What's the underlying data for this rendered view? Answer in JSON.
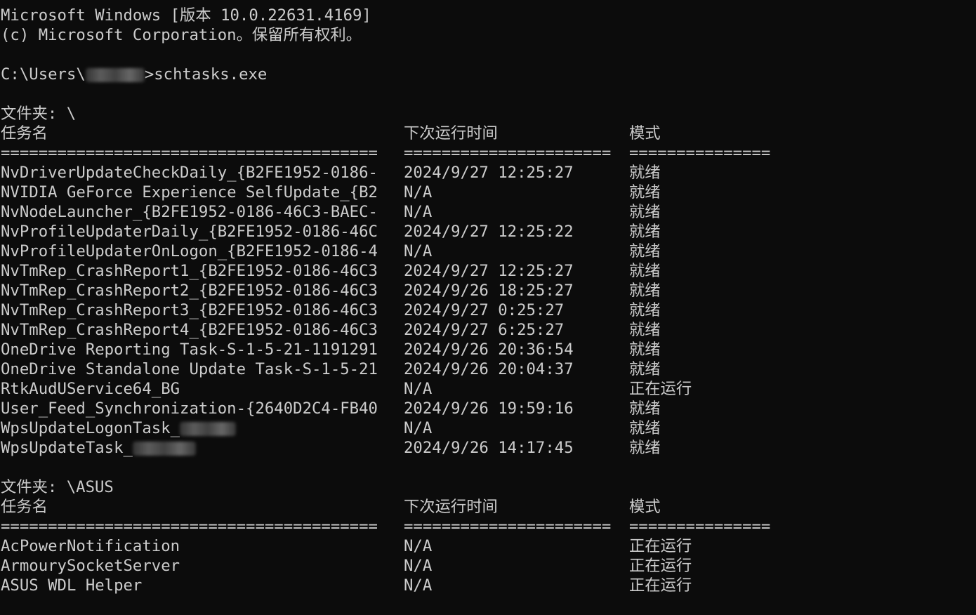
{
  "header": {
    "version_line": "Microsoft Windows [版本 10.0.22631.4169]",
    "copyright_line": "(c) Microsoft Corporation。保留所有权利。"
  },
  "prompt": {
    "path_prefix": "C:\\Users\\",
    "command": ">schtasks.exe"
  },
  "sections": [
    {
      "folder_label": "文件夹: \\",
      "headers": [
        "任务名",
        "下次运行时间",
        "模式"
      ],
      "separators": [
        "========================================",
        "======================",
        "==============="
      ],
      "rows": [
        {
          "name": "NvDriverUpdateCheckDaily_{B2FE1952-0186-",
          "next_run": "2024/9/27 12:25:27",
          "status": "就绪"
        },
        {
          "name": "NVIDIA GeForce Experience SelfUpdate_{B2",
          "next_run": "N/A",
          "status": "就绪"
        },
        {
          "name": "NvNodeLauncher_{B2FE1952-0186-46C3-BAEC-",
          "next_run": "N/A",
          "status": "就绪"
        },
        {
          "name": "NvProfileUpdaterDaily_{B2FE1952-0186-46C",
          "next_run": "2024/9/27 12:25:22",
          "status": "就绪"
        },
        {
          "name": "NvProfileUpdaterOnLogon_{B2FE1952-0186-4",
          "next_run": "N/A",
          "status": "就绪"
        },
        {
          "name": "NvTmRep_CrashReport1_{B2FE1952-0186-46C3",
          "next_run": "2024/9/27 12:25:27",
          "status": "就绪"
        },
        {
          "name": "NvTmRep_CrashReport2_{B2FE1952-0186-46C3",
          "next_run": "2024/9/26 18:25:27",
          "status": "就绪"
        },
        {
          "name": "NvTmRep_CrashReport3_{B2FE1952-0186-46C3",
          "next_run": "2024/9/27 0:25:27",
          "status": "就绪"
        },
        {
          "name": "NvTmRep_CrashReport4_{B2FE1952-0186-46C3",
          "next_run": "2024/9/27 6:25:27",
          "status": "就绪"
        },
        {
          "name": "OneDrive Reporting Task-S-1-5-21-1191291",
          "next_run": "2024/9/26 20:36:54",
          "status": "就绪"
        },
        {
          "name": "OneDrive Standalone Update Task-S-1-5-21",
          "next_run": "2024/9/26 20:04:37",
          "status": "就绪"
        },
        {
          "name": "RtkAudUService64_BG",
          "next_run": "N/A",
          "status": "正在运行"
        },
        {
          "name": "User_Feed_Synchronization-{2640D2C4-FB40",
          "next_run": "2024/9/26 19:59:16",
          "status": "就绪"
        },
        {
          "name": "WpsUpdateLogonTask_",
          "next_run": "N/A",
          "status": "就绪"
        },
        {
          "name": "WpsUpdateTask_",
          "next_run": "2024/9/26 14:17:45",
          "status": "就绪"
        }
      ]
    },
    {
      "folder_label": "文件夹: \\ASUS",
      "headers": [
        "任务名",
        "下次运行时间",
        "模式"
      ],
      "separators": [
        "========================================",
        "======================",
        "==============="
      ],
      "rows": [
        {
          "name": "AcPowerNotification",
          "next_run": "N/A",
          "status": "正在运行"
        },
        {
          "name": "ArmourySocketServer",
          "next_run": "N/A",
          "status": "正在运行"
        },
        {
          "name": "ASUS WDL Helper",
          "next_run": "N/A",
          "status": "正在运行"
        }
      ]
    }
  ]
}
